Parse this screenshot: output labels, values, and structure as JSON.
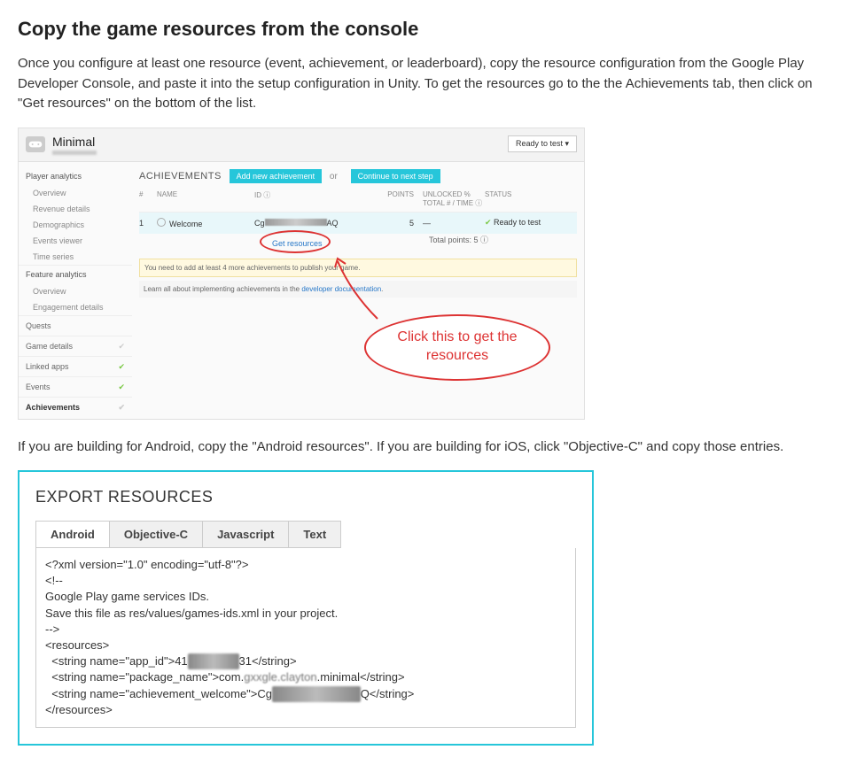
{
  "heading": "Copy the game resources from the console",
  "intro": "Once you configure at least one resource (event, achievement, or leaderboard), copy the resource configuration from the Google Play Developer Console, and paste it into the setup configuration in Unity. To get the resources go to the the Achievements tab, then click on \"Get resources\" on the bottom of the list.",
  "console": {
    "app_name": "Minimal",
    "ready_to_test": "Ready to test ▾",
    "side": {
      "player_analytics": "Player analytics",
      "overview": "Overview",
      "revenue": "Revenue details",
      "demographics": "Demographics",
      "events_viewer": "Events viewer",
      "time_series": "Time series",
      "feature_analytics": "Feature analytics",
      "overview2": "Overview",
      "engagement": "Engagement details",
      "quests": "Quests",
      "game_details": "Game details",
      "linked_apps": "Linked apps",
      "events": "Events",
      "achievements": "Achievements"
    },
    "main": {
      "title": "ACHIEVEMENTS",
      "add_btn": "Add new achievement",
      "or": "or",
      "continue_btn": "Continue to next step",
      "cols": {
        "num": "#",
        "name": "NAME",
        "id": "ID ⓘ",
        "points": "POINTS",
        "unlocked": "UNLOCKED %\nTOTAL # / TIME ⓘ",
        "status": "STATUS"
      },
      "row": {
        "num": "1",
        "name": "Welcome",
        "id_prefix": "Cg",
        "id_suffix": "AQ",
        "points": "5",
        "unlocked": "—",
        "status": "Ready to test"
      },
      "get_resources": "Get resources",
      "total": "Total points: 5 ⓘ",
      "warn": "You need to add at least 4 more achievements to publish your game.",
      "info_pre": "Learn all about implementing achievements in the ",
      "info_link": "developer documentation"
    },
    "callout": "Click this to get the resources"
  },
  "mid_text": "If you are building for Android, copy the \"Android resources\". If you are building for iOS, click \"Objective-C\" and copy those entries.",
  "export": {
    "title": "EXPORT RESOURCES",
    "tabs": [
      "Android",
      "Objective-C",
      "Javascript",
      "Text"
    ],
    "xml": {
      "l1": "<?xml version=\"1.0\" encoding=\"utf-8\"?>",
      "l2": "<!--",
      "l3": "Google Play game services IDs.",
      "l4": "Save this file as res/values/games-ids.xml in your project.",
      "l5": "-->",
      "l6": "<resources>",
      "l7a": "  <string name=\"app_id\">41",
      "l7b": "31</string>",
      "l8a": "  <string name=\"package_name\">com.",
      "l8mid": "gxxgle.clayton",
      "l8b": ".minimal</string>",
      "l9a": "  <string name=\"achievement_welcome\">Cg",
      "l9b": "Q</string>",
      "l10": "</resources>"
    }
  }
}
